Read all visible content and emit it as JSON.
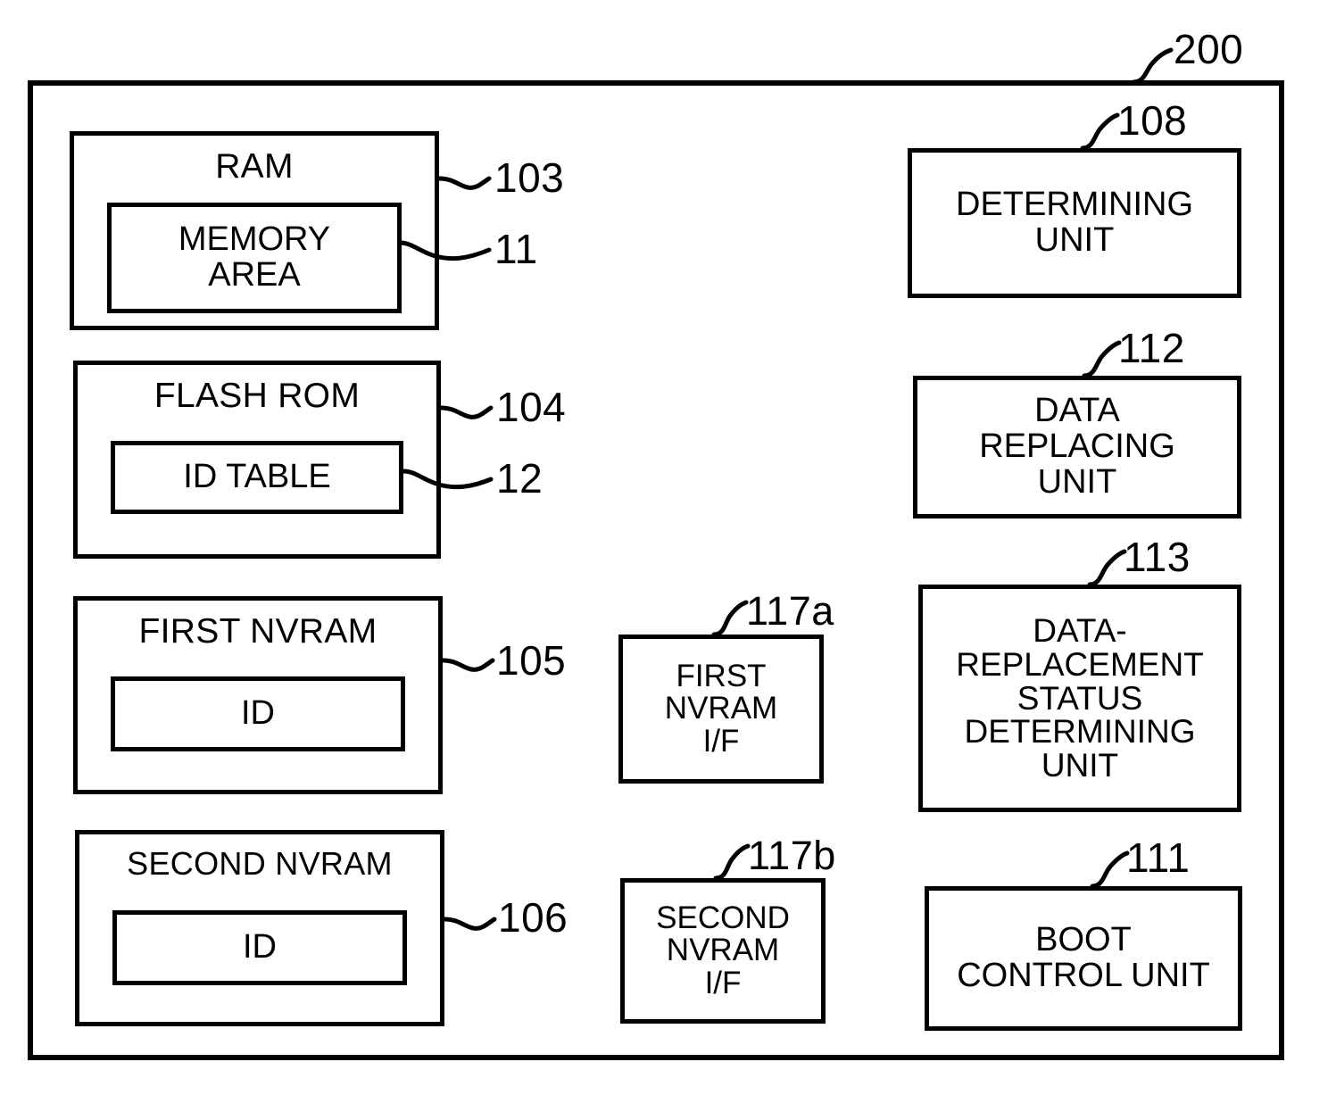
{
  "figure": {
    "system_ref": "200",
    "left_column": [
      {
        "name": "ram",
        "title": "RAM",
        "ref": "103",
        "inner": {
          "name": "memory-area",
          "label": "MEMORY\nAREA",
          "ref": "11"
        }
      },
      {
        "name": "flash-rom",
        "title": "FLASH ROM",
        "ref": "104",
        "inner": {
          "name": "id-table",
          "label": "ID TABLE",
          "ref": "12"
        }
      },
      {
        "name": "first-nvram",
        "title": "FIRST NVRAM",
        "ref": "105",
        "inner": {
          "name": "first-nvram-id",
          "label": "ID",
          "ref": ""
        }
      },
      {
        "name": "second-nvram",
        "title": "SECOND NVRAM",
        "ref": "106",
        "inner": {
          "name": "second-nvram-id",
          "label": "ID",
          "ref": ""
        }
      }
    ],
    "middle_column": [
      {
        "name": "first-nvram-if",
        "label": "FIRST\nNVRAM\nI/F",
        "ref": "117a"
      },
      {
        "name": "second-nvram-if",
        "label": "SECOND\nNVRAM\nI/F",
        "ref": "117b"
      }
    ],
    "right_column": [
      {
        "name": "determining-unit",
        "label": "DETERMINING\nUNIT",
        "ref": "108"
      },
      {
        "name": "data-replacing-unit",
        "label": "DATA\nREPLACING\nUNIT",
        "ref": "112"
      },
      {
        "name": "data-replacement-status-determining-unit",
        "label": "DATA-\nREPLACEMENT\nSTATUS\nDETERMINING\nUNIT",
        "ref": "113"
      },
      {
        "name": "boot-control-unit",
        "label": "BOOT\nCONTROL UNIT",
        "ref": "111"
      }
    ],
    "colors": {
      "line": "#000000",
      "background": "#ffffff"
    }
  }
}
